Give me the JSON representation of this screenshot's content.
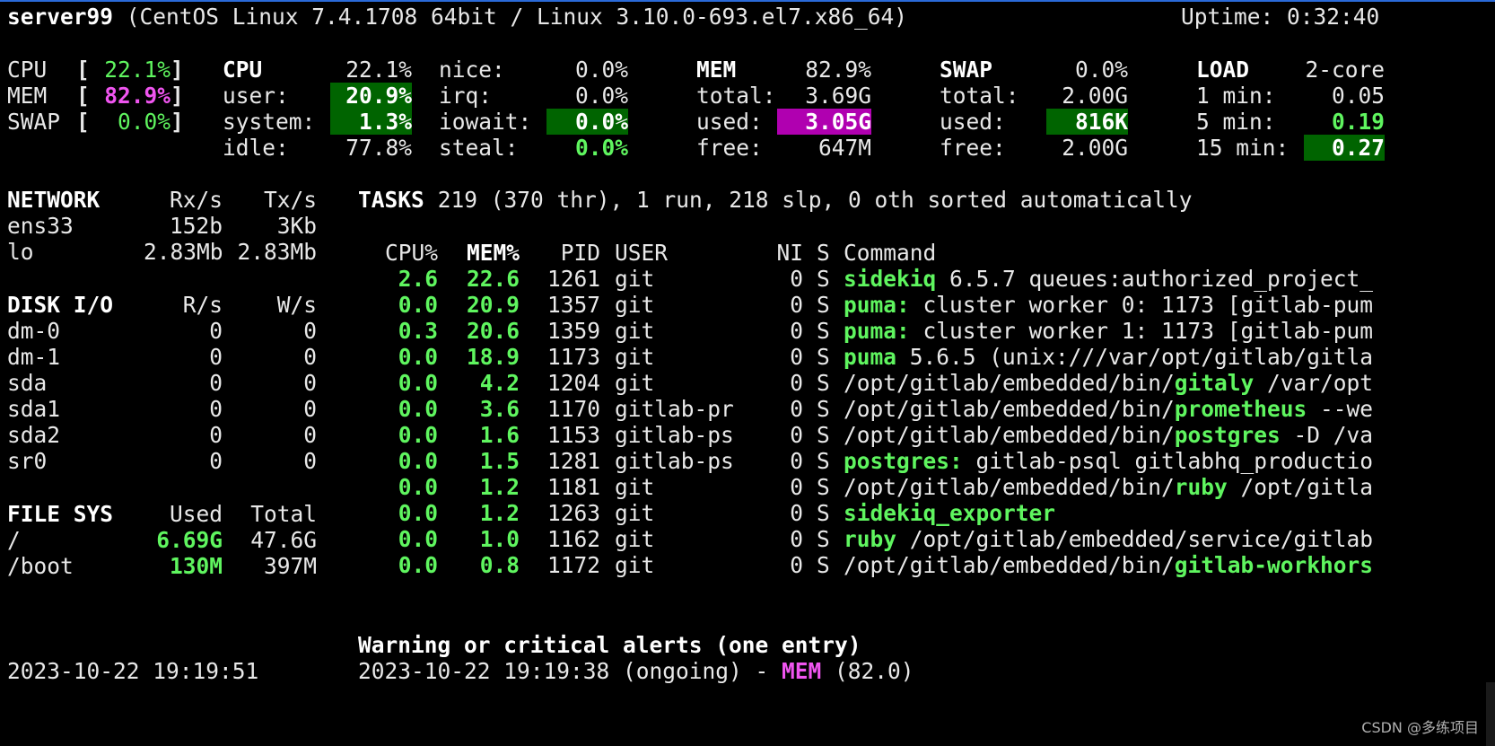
{
  "header": {
    "hostname": "server99",
    "os": " (CentOS Linux 7.4.1708 64bit / Linux 3.10.0-693.el7.x86_64)",
    "uptime": "Uptime: 0:32:40"
  },
  "quicklook": {
    "cpu_label": "CPU ",
    "cpu_value": "22.1%",
    "mem_label": "MEM ",
    "mem_value": "82.9%",
    "swap_label": "SWAP",
    "swap_value": "0.0%"
  },
  "cpu": {
    "title": "CPU",
    "total": "22.1%",
    "user_label": "user:",
    "user": "20.9%",
    "system_label": "system:",
    "system": "1.3%",
    "idle_label": "idle:",
    "idle": "77.8%",
    "nice_label": "nice:",
    "nice": "0.0%",
    "irq_label": "irq:",
    "irq": "0.0%",
    "iowait_label": "iowait:",
    "iowait": "0.0%",
    "steal_label": "steal:",
    "steal": "0.0%"
  },
  "mem": {
    "title": "MEM",
    "percent": "82.9%",
    "total_label": "total:",
    "total": "3.69G",
    "used_label": "used:",
    "used": "3.05G",
    "free_label": "free:",
    "free": "647M"
  },
  "swap": {
    "title": "SWAP",
    "percent": "0.0%",
    "total_label": "total:",
    "total": "2.00G",
    "used_label": "used:",
    "used": "816K",
    "free_label": "free:",
    "free": "2.00G"
  },
  "load": {
    "title": "LOAD",
    "cores": "2-core",
    "min1_label": "1 min:",
    "min1": "0.05",
    "min5_label": "5 min:",
    "min5": "0.19",
    "min15_label": "15 min:",
    "min15": "0.27"
  },
  "network": {
    "title": "NETWORK",
    "rx_header": "Rx/s",
    "tx_header": "Tx/s",
    "rows": [
      {
        "name": "ens33",
        "rx": "152b",
        "tx": "3Kb"
      },
      {
        "name": "lo",
        "rx": "2.83Mb",
        "tx": "2.83Mb"
      }
    ]
  },
  "diskio": {
    "title": "DISK I/O",
    "r_header": "R/s",
    "w_header": "W/s",
    "rows": [
      {
        "name": "dm-0",
        "r": "0",
        "w": "0"
      },
      {
        "name": "dm-1",
        "r": "0",
        "w": "0"
      },
      {
        "name": "sda",
        "r": "0",
        "w": "0"
      },
      {
        "name": "sda1",
        "r": "0",
        "w": "0"
      },
      {
        "name": "sda2",
        "r": "0",
        "w": "0"
      },
      {
        "name": "sr0",
        "r": "0",
        "w": "0"
      }
    ]
  },
  "filesys": {
    "title": "FILE SYS",
    "used_header": "Used",
    "total_header": "Total",
    "rows": [
      {
        "name": "/",
        "used": "6.69G",
        "total": "47.6G"
      },
      {
        "name": "/boot",
        "used": "130M",
        "total": "397M"
      }
    ]
  },
  "tasks": {
    "title": "TASKS",
    "summary": " 219 (370 thr), 1 run, 218 slp, 0 oth sorted automatically",
    "headers": {
      "cpu": "CPU%",
      "mem": "MEM%",
      "pid": "PID",
      "user": "USER",
      "ni": "NI",
      "s": "S",
      "cmd": "Command"
    },
    "rows": [
      {
        "cpu": "2.6",
        "mem": "22.6",
        "pid": "1261",
        "user": "git",
        "ni": "0",
        "s": "S",
        "pre": "",
        "prog": "sidekiq",
        "post": " 6.5.7 queues:authorized_project_"
      },
      {
        "cpu": "0.0",
        "mem": "20.9",
        "pid": "1357",
        "user": "git",
        "ni": "0",
        "s": "S",
        "pre": "",
        "prog": "puma:",
        "post": " cluster worker 0: 1173 [gitlab-pum"
      },
      {
        "cpu": "0.3",
        "mem": "20.6",
        "pid": "1359",
        "user": "git",
        "ni": "0",
        "s": "S",
        "pre": "",
        "prog": "puma:",
        "post": " cluster worker 1: 1173 [gitlab-pum"
      },
      {
        "cpu": "0.0",
        "mem": "18.9",
        "pid": "1173",
        "user": "git",
        "ni": "0",
        "s": "S",
        "pre": "",
        "prog": "puma",
        "post": " 5.6.5 (unix:///var/opt/gitlab/gitla"
      },
      {
        "cpu": "0.0",
        "mem": "4.2",
        "pid": "1204",
        "user": "git",
        "ni": "0",
        "s": "S",
        "pre": "/opt/gitlab/embedded/bin/",
        "prog": "gitaly",
        "post": " /var/opt"
      },
      {
        "cpu": "0.0",
        "mem": "3.6",
        "pid": "1170",
        "user": "gitlab-pr",
        "ni": "0",
        "s": "S",
        "pre": "/opt/gitlab/embedded/bin/",
        "prog": "prometheus",
        "post": " --we"
      },
      {
        "cpu": "0.0",
        "mem": "1.6",
        "pid": "1153",
        "user": "gitlab-ps",
        "ni": "0",
        "s": "S",
        "pre": "/opt/gitlab/embedded/bin/",
        "prog": "postgres",
        "post": " -D /va"
      },
      {
        "cpu": "0.0",
        "mem": "1.5",
        "pid": "1281",
        "user": "gitlab-ps",
        "ni": "0",
        "s": "S",
        "pre": "",
        "prog": "postgres:",
        "post": " gitlab-psql gitlabhq_productio"
      },
      {
        "cpu": "0.0",
        "mem": "1.2",
        "pid": "1181",
        "user": "git",
        "ni": "0",
        "s": "S",
        "pre": "/opt/gitlab/embedded/bin/",
        "prog": "ruby",
        "post": " /opt/gitla"
      },
      {
        "cpu": "0.0",
        "mem": "1.2",
        "pid": "1263",
        "user": "git",
        "ni": "0",
        "s": "S",
        "pre": "",
        "prog": "sidekiq_exporter",
        "post": ""
      },
      {
        "cpu": "0.0",
        "mem": "1.0",
        "pid": "1162",
        "user": "git",
        "ni": "0",
        "s": "S",
        "pre": "",
        "prog": "ruby",
        "post": " /opt/gitlab/embedded/service/gitlab"
      },
      {
        "cpu": "0.0",
        "mem": "0.8",
        "pid": "1172",
        "user": "git",
        "ni": "0",
        "s": "S",
        "pre": "/opt/gitlab/embedded/bin/",
        "prog": "gitlab-workhors",
        "post": ""
      }
    ]
  },
  "alerts": {
    "title": "Warning or critical alerts (one entry)",
    "entry_prefix": "2023-10-22 19:19:38 (ongoing) - ",
    "entry_metric": "MEM",
    "entry_suffix": " (82.0)"
  },
  "footer": {
    "datetime": "2023-10-22 19:19:51",
    "watermark": "CSDN @多练项目"
  },
  "colors": {
    "green": "#5ff55f",
    "magenta": "#f055f0",
    "ok_bg": "#006400",
    "critical_bg": "#b000b0"
  }
}
